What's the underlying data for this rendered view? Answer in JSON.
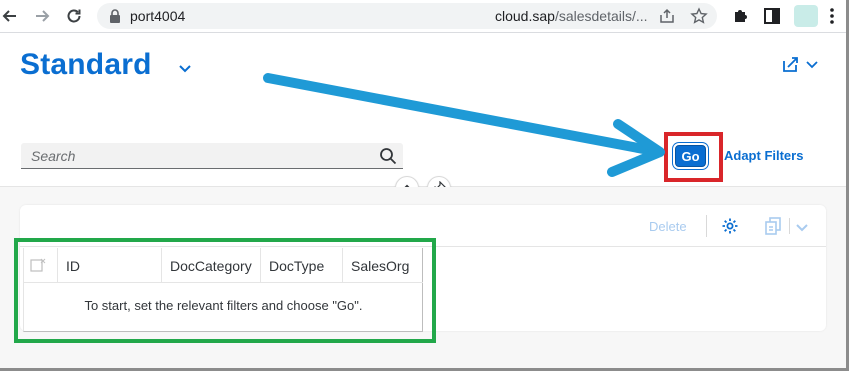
{
  "browser": {
    "url_host": "port4004",
    "url_domain": "cloud.sap",
    "url_path": "/salesdetails/..."
  },
  "page": {
    "title": "Standard"
  },
  "filter_bar": {
    "search_placeholder": "Search",
    "go_label": "Go",
    "adapt_filters_label": "Adapt Filters"
  },
  "table_toolbar": {
    "delete_label": "Delete"
  },
  "table": {
    "columns": [
      "ID",
      "DocCategory",
      "DocType",
      "SalesOrg"
    ],
    "no_data_text": "To start, set the relevant filters and choose \"Go\"."
  },
  "colors": {
    "sap_blue": "#0a6ed1",
    "annotation_arrow": "#1f9ad6",
    "highlight_red": "#d9262a",
    "highlight_green": "#22a84a"
  }
}
